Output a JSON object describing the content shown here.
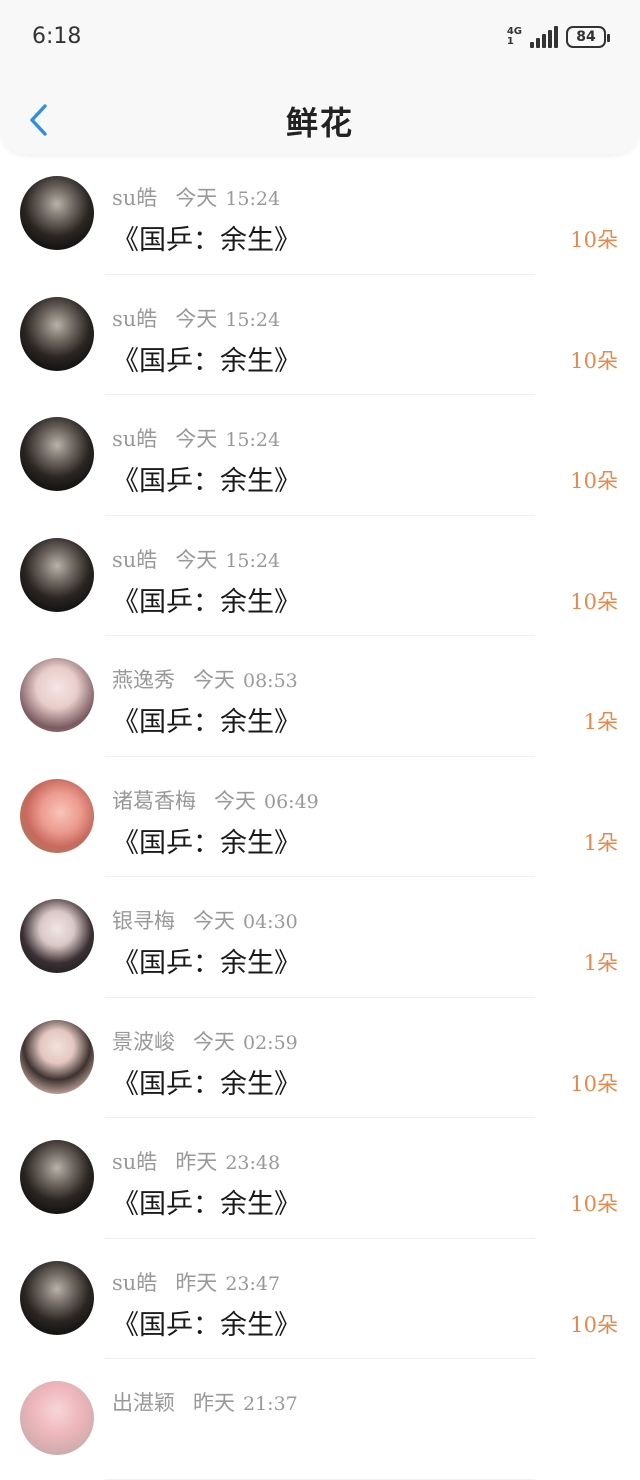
{
  "status_bar": {
    "time": "6:18",
    "network": "4G",
    "network_sub": "1",
    "battery": "84"
  },
  "header": {
    "title": "鲜花",
    "back_icon": "chevron-left-icon",
    "accent_color": "#2e8fe0"
  },
  "colors": {
    "count": "#e8884a",
    "meta": "#999999"
  },
  "list": [
    {
      "name": "su皓",
      "day": "今天",
      "time": "15:24",
      "book": "《国乒：余生》",
      "count": "10朵",
      "avatar": "dark"
    },
    {
      "name": "su皓",
      "day": "今天",
      "time": "15:24",
      "book": "《国乒：余生》",
      "count": "10朵",
      "avatar": "dark"
    },
    {
      "name": "su皓",
      "day": "今天",
      "time": "15:24",
      "book": "《国乒：余生》",
      "count": "10朵",
      "avatar": "dark"
    },
    {
      "name": "su皓",
      "day": "今天",
      "time": "15:24",
      "book": "《国乒：余生》",
      "count": "10朵",
      "avatar": "dark"
    },
    {
      "name": "燕逸秀",
      "day": "今天",
      "time": "08:53",
      "book": "《国乒：余生》",
      "count": "1朵",
      "avatar": "girl1"
    },
    {
      "name": "诸葛香梅",
      "day": "今天",
      "time": "06:49",
      "book": "《国乒：余生》",
      "count": "1朵",
      "avatar": "rose"
    },
    {
      "name": "银寻梅",
      "day": "今天",
      "time": "04:30",
      "book": "《国乒：余生》",
      "count": "1朵",
      "avatar": "girl2"
    },
    {
      "name": "景波峻",
      "day": "今天",
      "time": "02:59",
      "book": "《国乒：余生》",
      "count": "10朵",
      "avatar": "girl3"
    },
    {
      "name": "su皓",
      "day": "昨天",
      "time": "23:48",
      "book": "《国乒：余生》",
      "count": "10朵",
      "avatar": "dark"
    },
    {
      "name": "su皓",
      "day": "昨天",
      "time": "23:47",
      "book": "《国乒：余生》",
      "count": "10朵",
      "avatar": "dark"
    },
    {
      "name": "出湛颖",
      "day": "昨天",
      "time": "21:37",
      "book": "",
      "count": "",
      "avatar": "girl4"
    }
  ]
}
